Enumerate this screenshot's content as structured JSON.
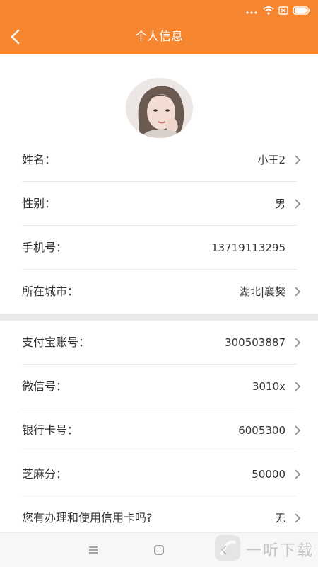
{
  "header": {
    "title": "个人信息"
  },
  "profile": {
    "rows": [
      {
        "label": "姓名：",
        "value": "小王2",
        "arrow": true
      },
      {
        "label": "性别：",
        "value": "男",
        "arrow": true
      },
      {
        "label": "手机号：",
        "value": "13719113295",
        "arrow": false
      },
      {
        "label": "所在城市：",
        "value": "湖北|襄樊",
        "arrow": true
      }
    ]
  },
  "accounts": {
    "rows": [
      {
        "label": "支付宝账号：",
        "value": "300503887",
        "arrow": true
      },
      {
        "label": "微信号：",
        "value": "3010x",
        "arrow": true
      },
      {
        "label": "银行卡号：",
        "value": "6005300",
        "arrow": true
      },
      {
        "label": "芝麻分：",
        "value": "50000",
        "arrow": true
      },
      {
        "label": "您有办理和使用信用卡吗?",
        "value": "无",
        "arrow": true
      }
    ]
  },
  "watermark": {
    "text": "一听下载"
  },
  "colors": {
    "brand": "#f6862f",
    "divider": "#e6e6e6",
    "section_gap": "#e9e9e9"
  },
  "icons": {
    "back": "chevron-left-icon",
    "row_arrow": "chevron-right-icon",
    "nav_menu": "menu-icon",
    "nav_home": "home-square-icon",
    "nav_back": "back-chevron-icon"
  }
}
